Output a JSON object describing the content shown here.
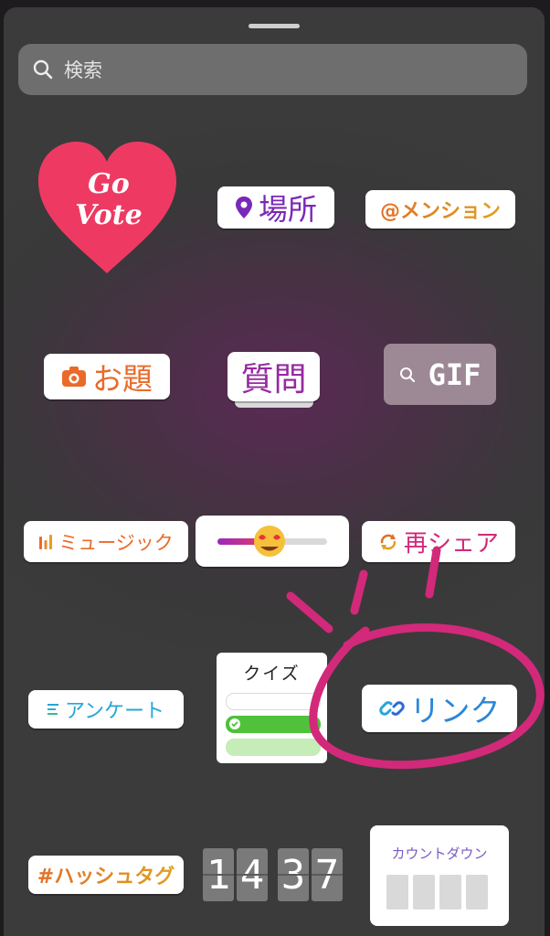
{
  "search": {
    "placeholder": "検索"
  },
  "stickers": {
    "go_vote": "Go Vote",
    "place": "場所",
    "mention": "@メンション",
    "odai": "お題",
    "question": "質問",
    "gif": "GIF",
    "music": "ミュージック",
    "reshare": "再シェア",
    "enquete": "アンケート",
    "quiz": "クイズ",
    "link": "リンク",
    "hashtag": "#ハッシュタグ",
    "countdown": "カウントダウン"
  },
  "clock": {
    "digits": [
      "1",
      "4",
      "3",
      "7"
    ]
  },
  "colors": {
    "annotation": "#d2297a",
    "heart": "#ee3a63"
  }
}
